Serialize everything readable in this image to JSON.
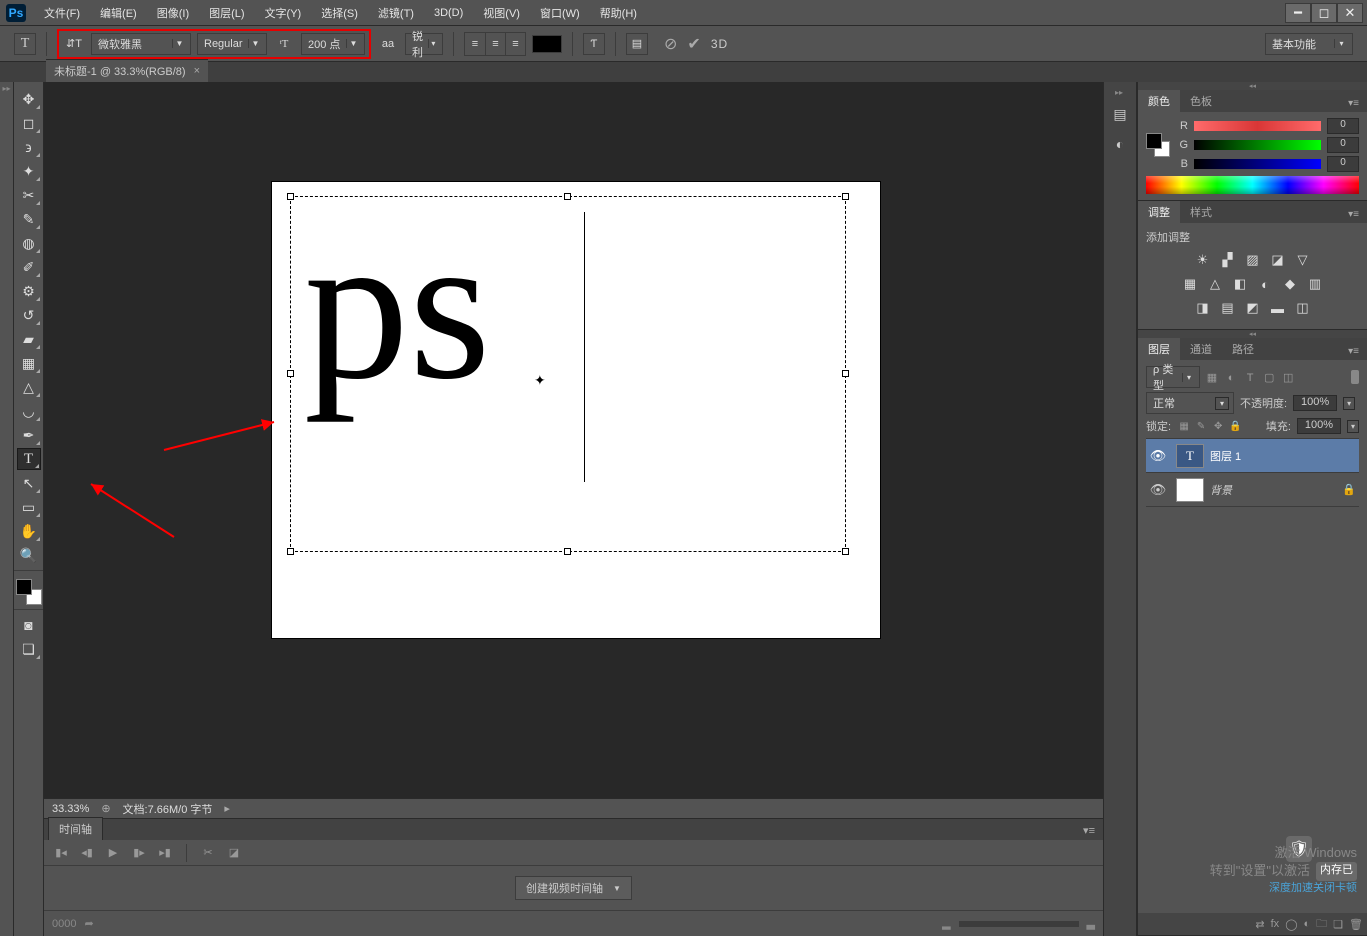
{
  "menu": [
    "文件(F)",
    "编辑(E)",
    "图像(I)",
    "图层(L)",
    "文字(Y)",
    "选择(S)",
    "滤镜(T)",
    "3D(D)",
    "视图(V)",
    "窗口(W)",
    "帮助(H)"
  ],
  "app_logo": "Ps",
  "options": {
    "font_family": "微软雅黑",
    "font_style": "Regular",
    "font_size": "200 点",
    "anti_alias": "锐利",
    "warp_label": "aa",
    "_3d": "3D"
  },
  "workspace": "基本功能",
  "doc_tab": "未标题-1 @ 33.3%(RGB/8)",
  "canvas_text": "ps",
  "status": {
    "zoom": "33.33%",
    "docinfo": "文档:7.66M/0 字节"
  },
  "timeline": {
    "tab": "时间轴",
    "create_button": "创建视频时间轴",
    "frame": "0000"
  },
  "panel_color": {
    "tab_color": "颜色",
    "tab_swatches": "色板",
    "channels": {
      "R": "0",
      "G": "0",
      "B": "0"
    }
  },
  "panel_adjust": {
    "tab_adjust": "调整",
    "tab_styles": "样式",
    "label": "添加调整"
  },
  "panel_layers": {
    "tab_layers": "图层",
    "tab_channels": "通道",
    "tab_paths": "路径",
    "kind": "ρ 类型",
    "blend": "正常",
    "opacity_label": "不透明度:",
    "opacity": "100%",
    "lock_label": "锁定:",
    "fill_label": "填充:",
    "fill": "100%",
    "layer_text": "图层 1",
    "layer_bg": "背景"
  },
  "watermark": {
    "line1": "激活 Windows",
    "line2": "转到\"设置\"以激活",
    "line3": "深度加速关闭卡顿",
    "badge": "内存已"
  }
}
